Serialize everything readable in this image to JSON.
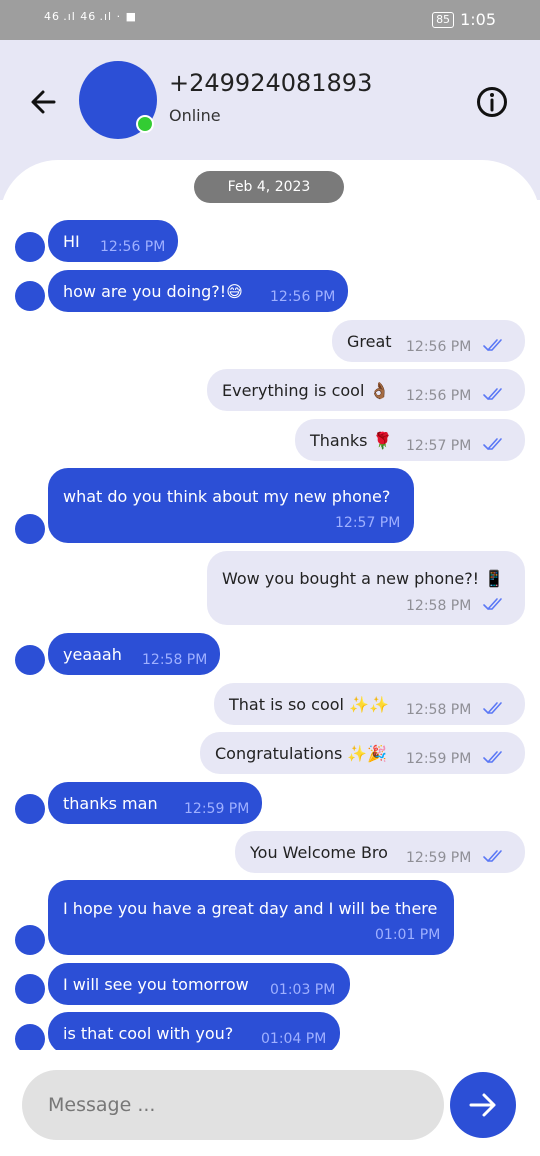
{
  "status_bar": {
    "signal": "46 .ıl 46 .ıl · ■",
    "battery": "85",
    "time": "1:05"
  },
  "header": {
    "contact_name": "+249924081893",
    "contact_status": "Online",
    "back_icon": "arrow-left-icon",
    "info_icon": "info-circle-icon"
  },
  "chat": {
    "date": "Feb 4, 2023",
    "messages": [
      {
        "dir": "in",
        "text": "HI",
        "time": "12:56 PM"
      },
      {
        "dir": "in",
        "text": "how are you doing?!😅",
        "time": "12:56 PM"
      },
      {
        "dir": "out",
        "text": "Great",
        "time": "12:56 PM"
      },
      {
        "dir": "out",
        "text": "Everything is cool 👌🏾",
        "time": "12:56 PM"
      },
      {
        "dir": "out",
        "text": "Thanks 🌹",
        "time": "12:57 PM"
      },
      {
        "dir": "in",
        "text": "what do you think about my new phone?",
        "time": "12:57 PM"
      },
      {
        "dir": "out",
        "text": "Wow you bought a new phone?! 📱",
        "time": "12:58 PM"
      },
      {
        "dir": "in",
        "text": "yeaaah",
        "time": "12:58 PM"
      },
      {
        "dir": "out",
        "text": "That is so cool ✨✨",
        "time": "12:58 PM"
      },
      {
        "dir": "out",
        "text": "Congratulations ✨🎉",
        "time": "12:59 PM"
      },
      {
        "dir": "in",
        "text": "thanks man",
        "time": "12:59 PM"
      },
      {
        "dir": "out",
        "text": "You Welcome Bro",
        "time": "12:59 PM"
      },
      {
        "dir": "in",
        "text": "I hope you have a great day and I will be there",
        "time": "01:01 PM"
      },
      {
        "dir": "in",
        "text": "I will see you tomorrow",
        "time": "01:03 PM"
      },
      {
        "dir": "in",
        "text": "is that cool with you?",
        "time": "01:04 PM"
      }
    ]
  },
  "composer": {
    "placeholder": "Message ...",
    "send_icon": "arrow-right-icon"
  },
  "colors": {
    "accent": "#2c4fd6",
    "header_bg": "#e7e7f5",
    "outgoing_bubble": "#e7e7f5",
    "online": "#33cc33"
  }
}
